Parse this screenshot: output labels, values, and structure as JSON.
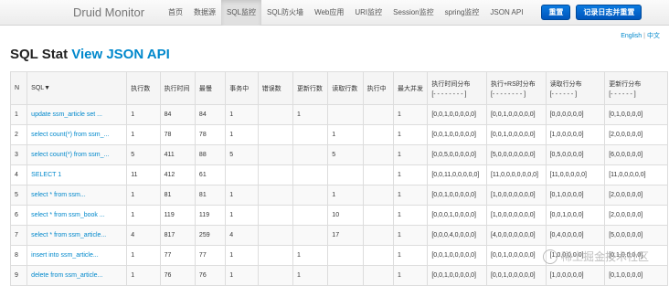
{
  "nav": {
    "brand": "Druid Monitor",
    "items": [
      "首页",
      "数据源",
      "SQL监控",
      "SQL防火墙",
      "Web应用",
      "URI监控",
      "Session监控",
      "spring监控",
      "JSON API"
    ],
    "active_index": 2,
    "reset_label": "重置",
    "log_reset_label": "记录日志并重置"
  },
  "lang": {
    "english": "English",
    "sep": "|",
    "chinese": "中文"
  },
  "title": {
    "prefix": "SQL Stat",
    "api_link": "View JSON API"
  },
  "table": {
    "headers": [
      {
        "main": "N"
      },
      {
        "main": "SQL▼"
      },
      {
        "main": "执行数"
      },
      {
        "main": "执行时间"
      },
      {
        "main": "最慢"
      },
      {
        "main": "事务中"
      },
      {
        "main": "错误数"
      },
      {
        "main": "更新行数"
      },
      {
        "main": "读取行数"
      },
      {
        "main": "执行中"
      },
      {
        "main": "最大并发"
      },
      {
        "main": "执行时间分布",
        "sub": "[- - - - - - - - ]"
      },
      {
        "main": "执行+RS时分布",
        "sub": "[- - - - - - - - ]"
      },
      {
        "main": "读取行分布",
        "sub": "[- - - - - - ]"
      },
      {
        "main": "更新行分布",
        "sub": "[- - - - - - ]"
      }
    ],
    "rows": [
      [
        "1",
        "update ssm_article set ...",
        "1",
        "84",
        "84",
        "1",
        "",
        "1",
        "",
        "",
        "1",
        "[0,0,1,0,0,0,0,0]",
        "[0,0,1,0,0,0,0,0]",
        "[0,0,0,0,0,0]",
        "[0,1,0,0,0,0]"
      ],
      [
        "2",
        "select count(*) from ssm_...",
        "1",
        "78",
        "78",
        "1",
        "",
        "",
        "1",
        "",
        "1",
        "[0,0,1,0,0,0,0,0]",
        "[0,0,1,0,0,0,0,0]",
        "[1,0,0,0,0,0]",
        "[2,0,0,0,0,0]"
      ],
      [
        "3",
        "select count(*) from ssm_...",
        "5",
        "411",
        "88",
        "5",
        "",
        "",
        "5",
        "",
        "1",
        "[0,0,5,0,0,0,0,0]",
        "[5,0,0,0,0,0,0,0]",
        "[0,5,0,0,0,0]",
        "[6,0,0,0,0,0]"
      ],
      [
        "4",
        "SELECT 1",
        "11",
        "412",
        "61",
        "",
        "",
        "",
        "",
        "",
        "1",
        "[0,0,11,0,0,0,0,0]",
        "[11,0,0,0,0,0,0,0]",
        "[11,0,0,0,0,0]",
        "[11,0,0,0,0,0]"
      ],
      [
        "5",
        "select * from ssm...",
        "1",
        "81",
        "81",
        "1",
        "",
        "",
        "1",
        "",
        "1",
        "[0,0,1,0,0,0,0,0]",
        "[1,0,0,0,0,0,0,0]",
        "[0,1,0,0,0,0]",
        "[2,0,0,0,0,0]"
      ],
      [
        "6",
        "select * from ssm_book ...",
        "1",
        "119",
        "119",
        "1",
        "",
        "",
        "10",
        "",
        "1",
        "[0,0,0,1,0,0,0,0]",
        "[1,0,0,0,0,0,0,0]",
        "[0,0,1,0,0,0]",
        "[2,0,0,0,0,0]"
      ],
      [
        "7",
        "select * from ssm_article...",
        "4",
        "817",
        "259",
        "4",
        "",
        "",
        "17",
        "",
        "1",
        "[0,0,0,4,0,0,0,0]",
        "[4,0,0,0,0,0,0,0]",
        "[0,4,0,0,0,0]",
        "[5,0,0,0,0,0]"
      ],
      [
        "8",
        "insert into ssm_article...",
        "1",
        "77",
        "77",
        "1",
        "",
        "1",
        "",
        "",
        "1",
        "[0,0,1,0,0,0,0,0]",
        "[0,0,1,0,0,0,0,0]",
        "[1,0,0,0,0,0]",
        "[0,1,0,0,0,0]"
      ],
      [
        "9",
        "delete from ssm_article...",
        "1",
        "76",
        "76",
        "1",
        "",
        "1",
        "",
        "",
        "1",
        "[0,0,1,0,0,0,0,0]",
        "[0,0,1,0,0,0,0,0]",
        "[1,0,0,0,0,0]",
        "[0,1,0,0,0,0]"
      ]
    ]
  },
  "watermark": "稀土掘金技术社区"
}
